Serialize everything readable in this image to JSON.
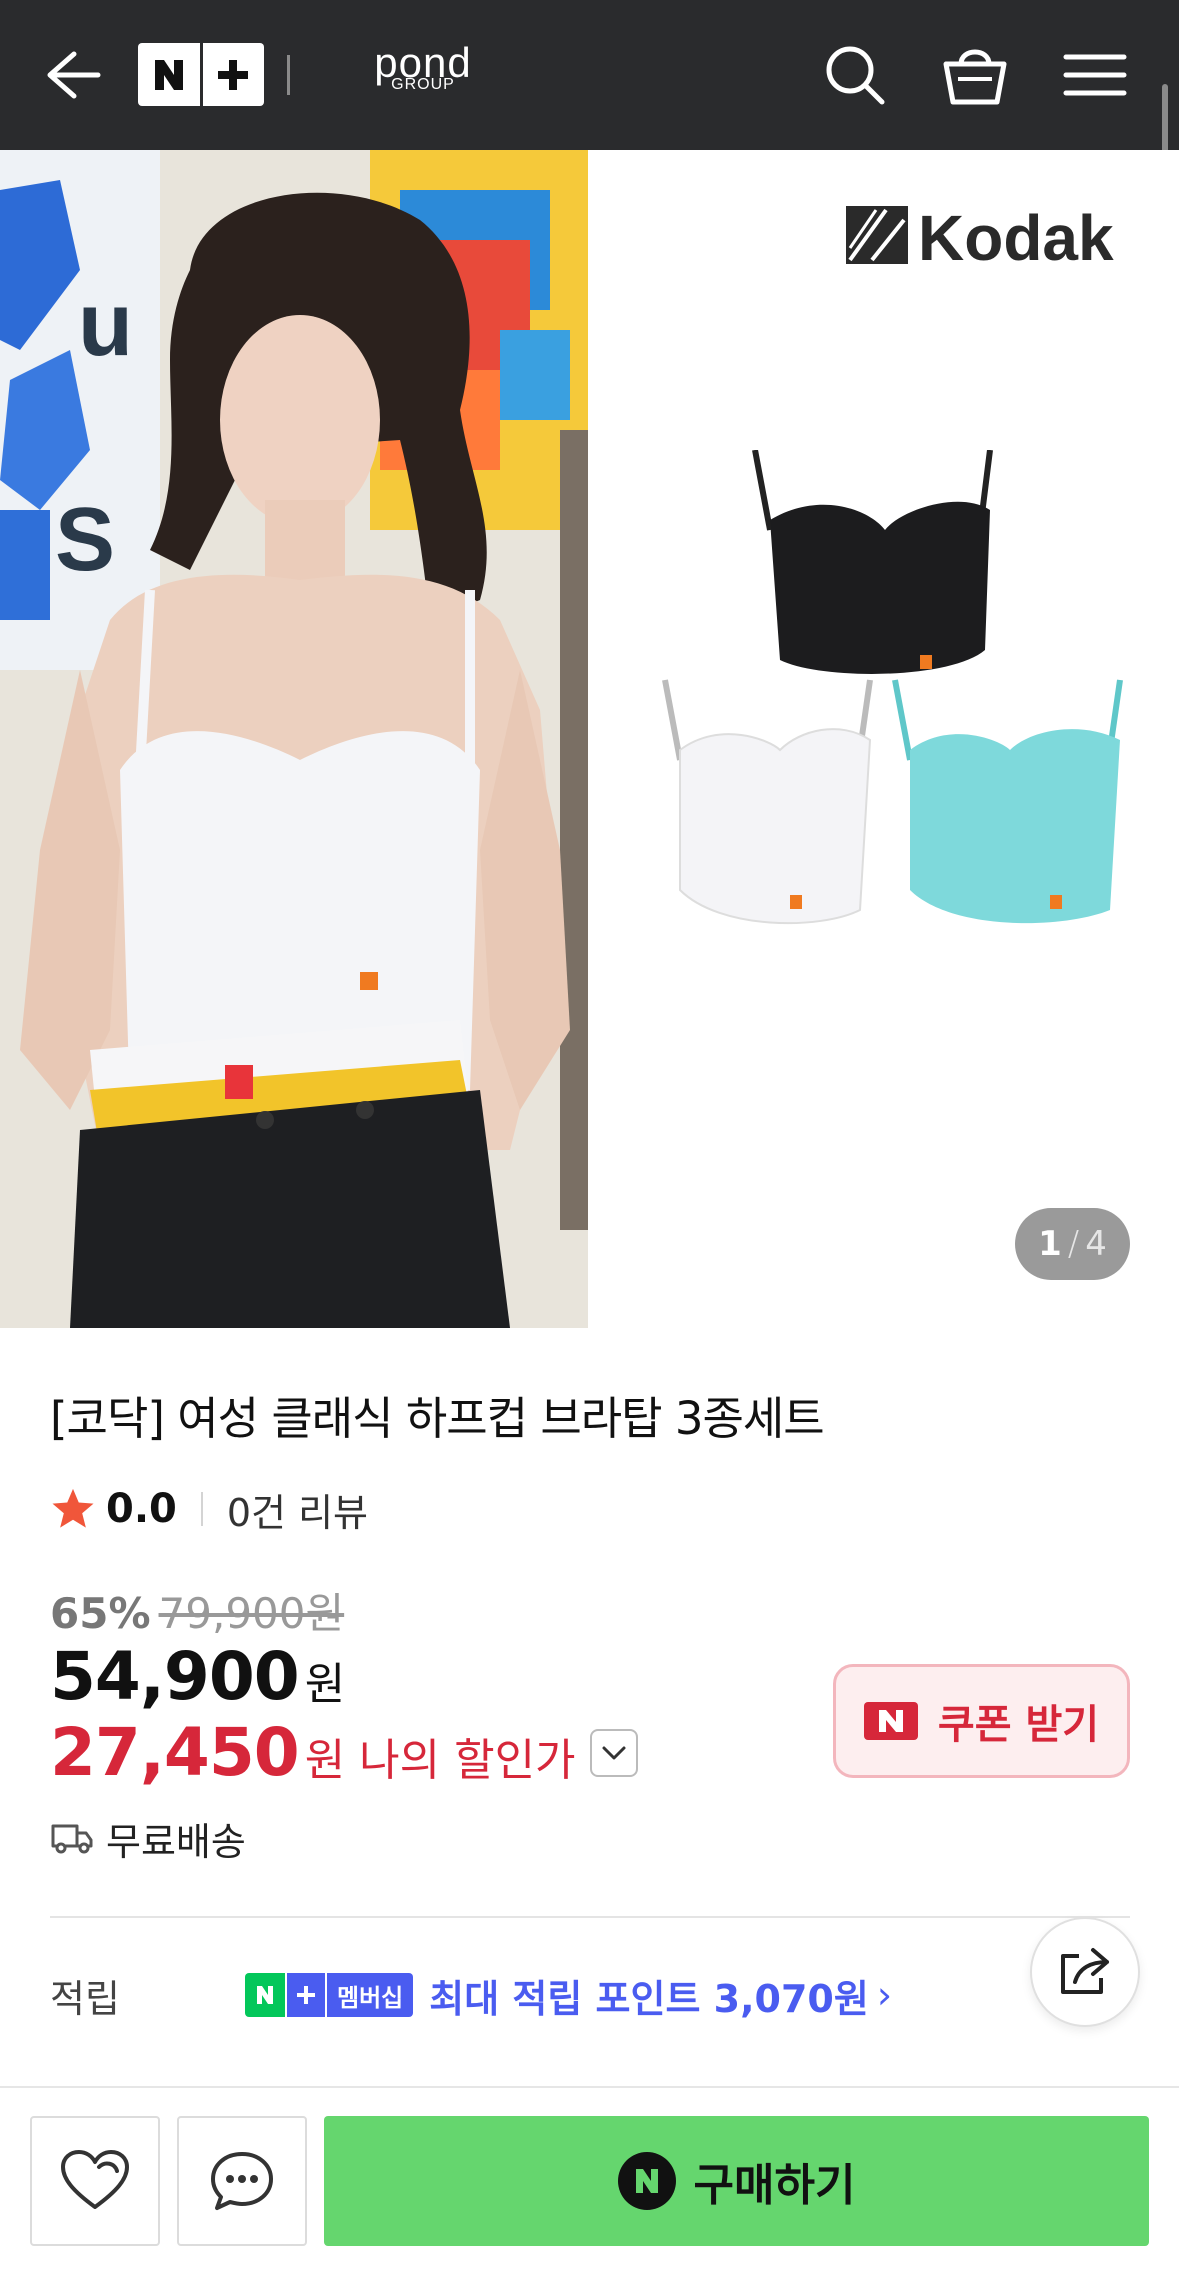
{
  "topbar": {
    "brand": "pond",
    "brand_sub": "GROUP",
    "icons": [
      "back-arrow-icon",
      "naver-plus-icon",
      "search-icon",
      "shopping-bag-icon",
      "menu-icon"
    ]
  },
  "gallery": {
    "brand_logo": "Kodak",
    "current": "1",
    "total": "4",
    "slash": "/"
  },
  "product": {
    "title": "[코닥] 여성 클래식 하프컵 브라탑 3종세트",
    "rating": "0.0",
    "review_count": "0건 리뷰",
    "discount_pct": "65%",
    "original_price": "79,900원",
    "price": "54,900",
    "price_unit": "원",
    "my_price": "27,450",
    "my_price_label": "원 나의 할인가",
    "shipping": "무료배송"
  },
  "coupon": {
    "label": "쿠폰 받기"
  },
  "points": {
    "label": "적립",
    "badge_membership": "멤버십",
    "value": "최대 적립 포인트 3,070원",
    "arrow": "›"
  },
  "bottom": {
    "buy_label": "구매하기"
  },
  "colors": {
    "topbar_bg": "#2a2b2d",
    "price_red": "#d6273a",
    "naver_green": "#03c75a",
    "buy_green": "#65d66e",
    "membership_blue": "#4a5cf0",
    "star": "#f0563a"
  }
}
